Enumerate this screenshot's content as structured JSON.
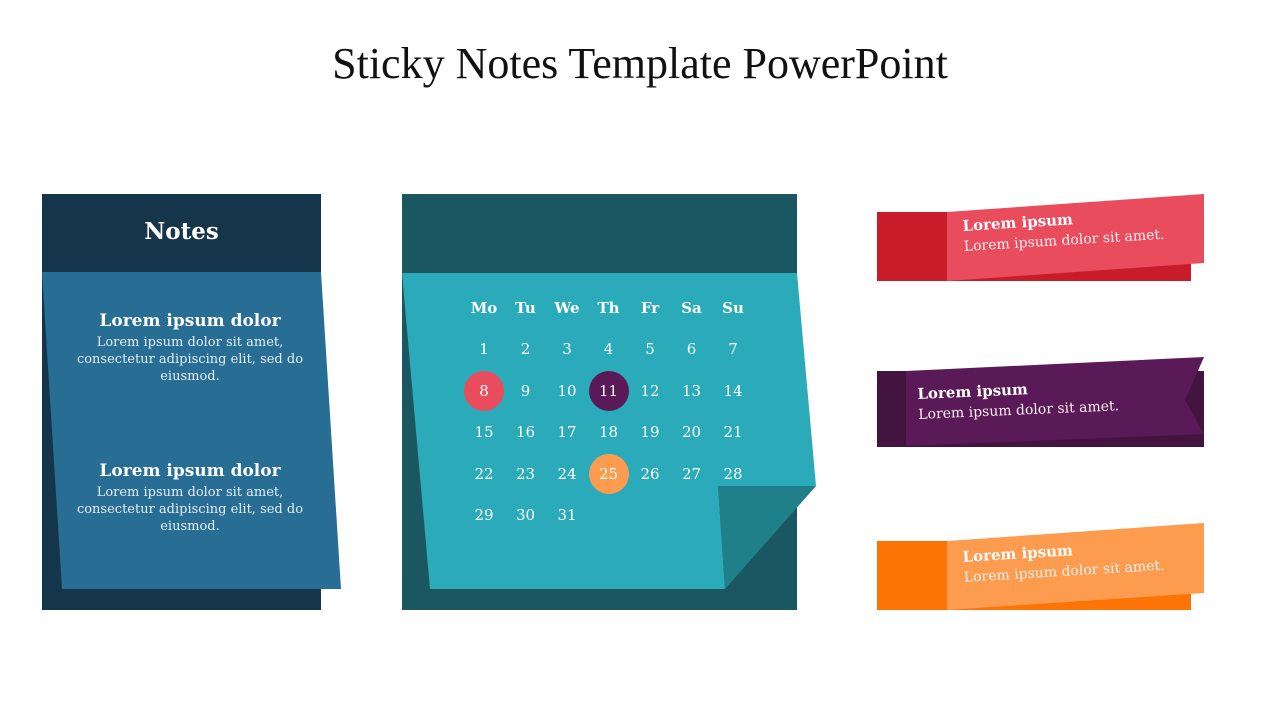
{
  "slide": {
    "title": "Sticky Notes Template PowerPoint"
  },
  "notes_card": {
    "heading": "Notes",
    "items": [
      {
        "title": "Lorem ipsum dolor",
        "text": "Lorem ipsum dolor sit amet, consectetur adipiscing elit, sed do eiusmod."
      },
      {
        "title": "Lorem ipsum dolor",
        "text": "Lorem ipsum dolor sit amet, consectetur adipiscing elit, sed do eiusmod."
      }
    ],
    "colors": {
      "back": "#15354a",
      "front": "#286d94"
    }
  },
  "calendar": {
    "weekdays": [
      "Mo",
      "Tu",
      "We",
      "Th",
      "Fr",
      "Sa",
      "Su"
    ],
    "weeks": [
      [
        "1",
        "2",
        "3",
        "4",
        "5",
        "6",
        "7"
      ],
      [
        "8",
        "9",
        "10",
        "11",
        "12",
        "13",
        "14"
      ],
      [
        "15",
        "16",
        "17",
        "18",
        "19",
        "20",
        "21"
      ],
      [
        "22",
        "23",
        "24",
        "25",
        "26",
        "27",
        "28"
      ],
      [
        "29",
        "30",
        "31",
        "",
        "",
        "",
        ""
      ]
    ],
    "highlights": [
      {
        "day": "8",
        "color": "#e84c5d"
      },
      {
        "day": "11",
        "color": "#5a1a57"
      },
      {
        "day": "25",
        "color": "#fd9c4f"
      }
    ],
    "colors": {
      "back": "#1b5760",
      "front": "#2babb9",
      "fold": "#20808a"
    }
  },
  "ribbons": [
    {
      "title": "Lorem ipsum",
      "text": "Lorem ipsum dolor sit amet.",
      "color": "#e84c5d",
      "dark": "#c91c2b"
    },
    {
      "title": "Lorem ipsum",
      "text": "Lorem ipsum dolor sit amet.",
      "color": "#5a1a57",
      "dark": "#431440"
    },
    {
      "title": "Lorem ipsum",
      "text": "Lorem ipsum dolor sit amet.",
      "color": "#fd9c4f",
      "dark": "#fb7405"
    }
  ]
}
